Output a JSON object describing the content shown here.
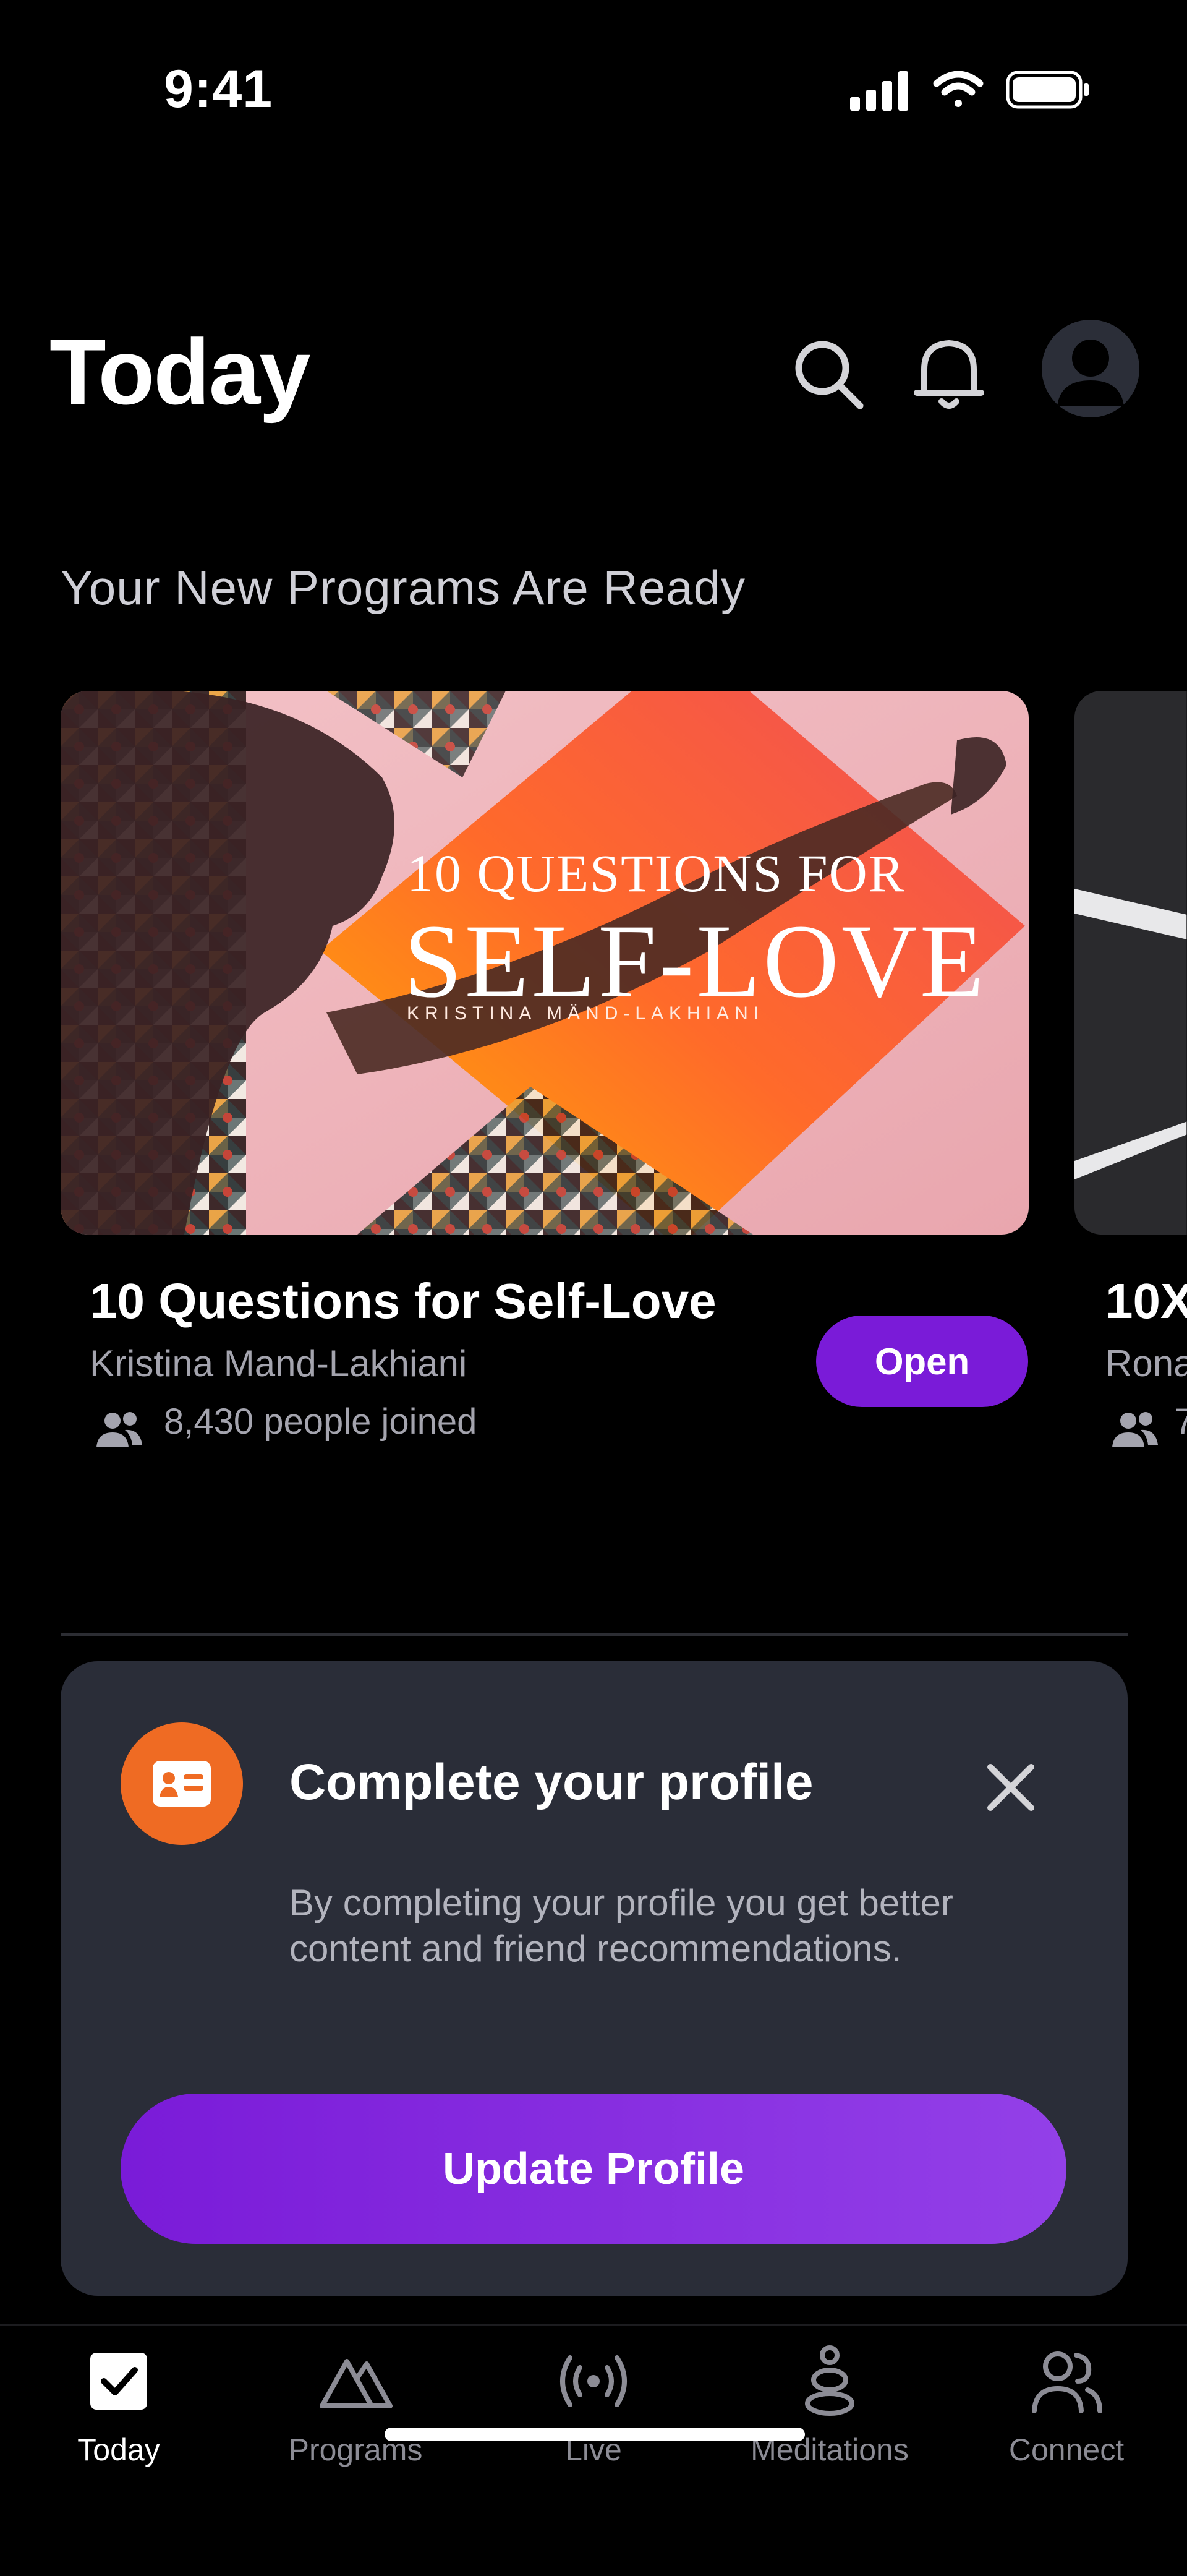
{
  "status_bar": {
    "time": "9:41"
  },
  "header": {
    "title": "Today"
  },
  "section": {
    "title": "Your New Programs Are Ready"
  },
  "programs": [
    {
      "cover_title_line1": "10 QUESTIONS FOR",
      "cover_title_line2": "SELF-LOVE",
      "cover_author": "KRISTINA MÄND-LAKHIANI",
      "title": "10 Questions for Self-Love",
      "author": "Kristina Mand-Lakhiani",
      "joined": "8,430 people joined",
      "button": "Open"
    },
    {
      "title": "10X",
      "author": "Rona",
      "joined": "7"
    }
  ],
  "profile_card": {
    "title": "Complete your profile",
    "description": "By completing your profile you get better content and friend recommendations.",
    "button": "Update Profile"
  },
  "tabs": [
    {
      "label": "Today",
      "icon": "checkbox-icon",
      "active": true
    },
    {
      "label": "Programs",
      "icon": "mountain-icon",
      "active": false
    },
    {
      "label": "Live",
      "icon": "broadcast-icon",
      "active": false
    },
    {
      "label": "Meditations",
      "icon": "meditation-icon",
      "active": false
    },
    {
      "label": "Connect",
      "icon": "people-icon",
      "active": false
    }
  ],
  "colors": {
    "accent": "#7a1bd8",
    "profile_icon": "#ef6b23",
    "card_bg": "#2a2d38"
  }
}
